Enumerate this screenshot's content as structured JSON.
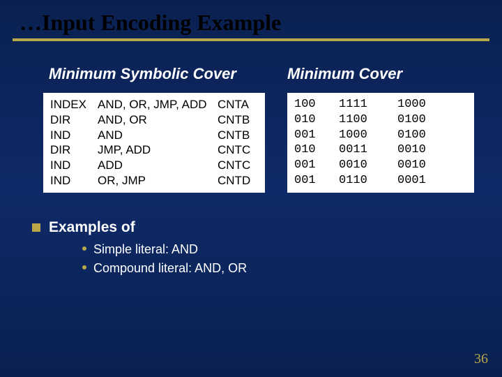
{
  "title": "…Input Encoding Example",
  "subheads": {
    "left": "Minimum Symbolic Cover",
    "right": "Minimum  Cover"
  },
  "symbolic": [
    {
      "c1": "INDEX",
      "c2": "AND, OR, JMP, ADD",
      "c3": "CNTA"
    },
    {
      "c1": "DIR",
      "c2": "AND, OR",
      "c3": "CNTB"
    },
    {
      "c1": "IND",
      "c2": "AND",
      "c3": "CNTB"
    },
    {
      "c1": "DIR",
      "c2": "JMP, ADD",
      "c3": "CNTC"
    },
    {
      "c1": "IND",
      "c2": "ADD",
      "c3": "CNTC"
    },
    {
      "c1": "IND",
      "c2": "OR, JMP",
      "c3": "CNTD"
    }
  ],
  "mincover": [
    {
      "c1": "100",
      "c2": "1111",
      "c3": "1000"
    },
    {
      "c1": "010",
      "c2": "1100",
      "c3": "0100"
    },
    {
      "c1": "001",
      "c2": "1000",
      "c3": "0100"
    },
    {
      "c1": "010",
      "c2": "0011",
      "c3": "0010"
    },
    {
      "c1": "001",
      "c2": "0010",
      "c3": "0010"
    },
    {
      "c1": "001",
      "c2": "0110",
      "c3": "0001"
    }
  ],
  "examples": {
    "heading": "Examples of",
    "items": [
      "Simple literal: AND",
      "Compound literal: AND, OR"
    ]
  },
  "page": "36"
}
